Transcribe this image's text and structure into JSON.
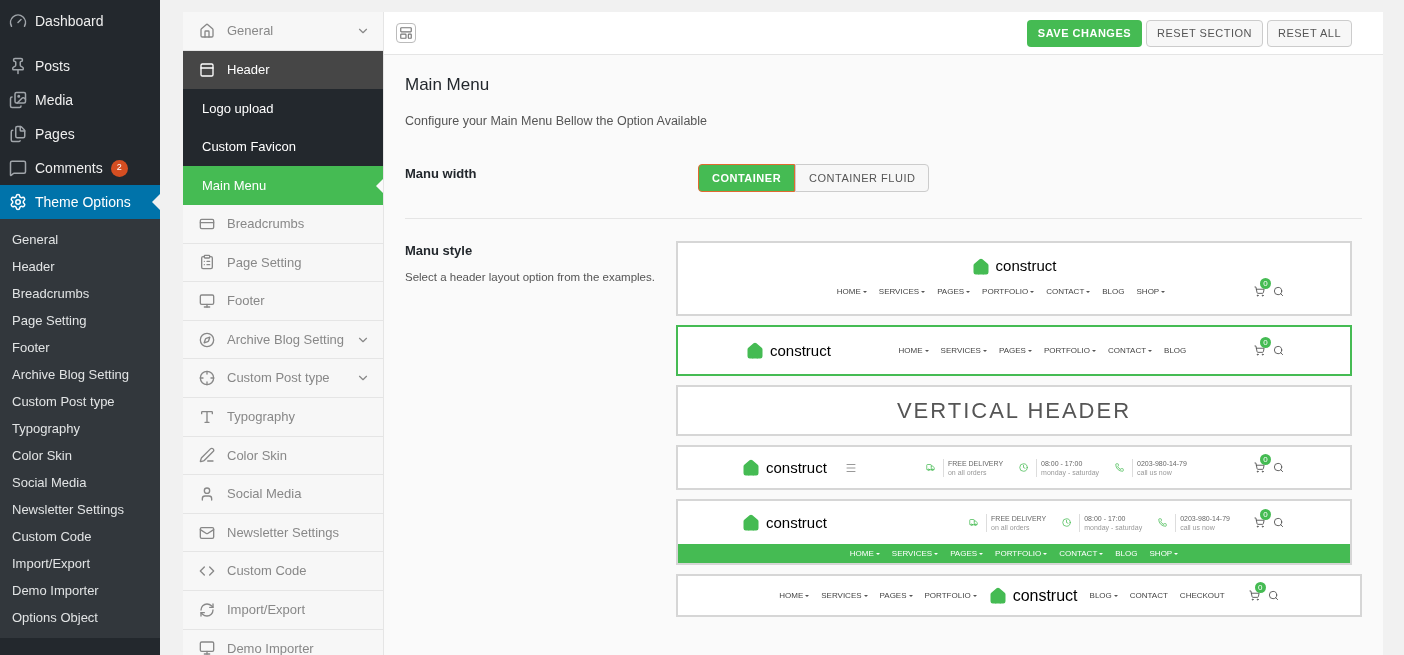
{
  "wp_menu": {
    "items": [
      {
        "label": "Dashboard",
        "selected": false
      },
      {
        "label": "Posts",
        "selected": false
      },
      {
        "label": "Media",
        "selected": false
      },
      {
        "label": "Pages",
        "selected": false
      },
      {
        "label": "Comments",
        "selected": false,
        "badge": "2"
      },
      {
        "label": "Theme Options",
        "selected": true
      }
    ],
    "submenu": [
      "General",
      "Header",
      "Breadcrumbs",
      "Page Setting",
      "Footer",
      "Archive Blog Setting",
      "Custom Post type",
      "Typography",
      "Color Skin",
      "Social Media",
      "Newsletter Settings",
      "Custom Code",
      "Import/Export",
      "Demo Importer",
      "Options Object"
    ]
  },
  "options_nav": [
    {
      "label": "General",
      "kind": "section",
      "selected": false,
      "expandable": true
    },
    {
      "label": "Header",
      "kind": "section",
      "selected": true,
      "expandable": false
    },
    {
      "label": "Logo upload",
      "kind": "sub",
      "selected": false
    },
    {
      "label": "Custom Favicon",
      "kind": "sub",
      "selected": false
    },
    {
      "label": "Main Menu",
      "kind": "sub",
      "selected": true
    },
    {
      "label": "Breadcrumbs",
      "kind": "section",
      "selected": false,
      "expandable": false
    },
    {
      "label": "Page Setting",
      "kind": "section",
      "selected": false,
      "expandable": false
    },
    {
      "label": "Footer",
      "kind": "section",
      "selected": false,
      "expandable": false
    },
    {
      "label": "Archive Blog Setting",
      "kind": "section",
      "selected": false,
      "expandable": true
    },
    {
      "label": "Custom Post type",
      "kind": "section",
      "selected": false,
      "expandable": true
    },
    {
      "label": "Typography",
      "kind": "section",
      "selected": false,
      "expandable": false
    },
    {
      "label": "Color Skin",
      "kind": "section",
      "selected": false,
      "expandable": false
    },
    {
      "label": "Social Media",
      "kind": "section",
      "selected": false,
      "expandable": false
    },
    {
      "label": "Newsletter Settings",
      "kind": "section",
      "selected": false,
      "expandable": false
    },
    {
      "label": "Custom Code",
      "kind": "section",
      "selected": false,
      "expandable": false
    },
    {
      "label": "Import/Export",
      "kind": "section",
      "selected": false,
      "expandable": false
    },
    {
      "label": "Demo Importer",
      "kind": "section",
      "selected": false,
      "expandable": false
    }
  ],
  "toolbar": {
    "buttons": [
      {
        "label": "SAVE CHANGES",
        "kind": "primary"
      },
      {
        "label": "RESET SECTION",
        "kind": "default"
      },
      {
        "label": "RESET ALL",
        "kind": "default"
      }
    ]
  },
  "section": {
    "title": "Main Menu",
    "description": "Configure your Main Menu Bellow the Option Available"
  },
  "menu_width": {
    "label": "Manu width",
    "options": [
      {
        "label": "CONTAINER",
        "selected": true
      },
      {
        "label": "CONTAINER FLUID",
        "selected": false
      }
    ]
  },
  "menu_style": {
    "label": "Manu style",
    "description": "Select a header layout option from the examples.",
    "layouts": [
      {
        "kind": "centered",
        "selected": false,
        "logo": "construct",
        "cart_count": "0",
        "nav": [
          {
            "label": "HOME",
            "dropdown": true
          },
          {
            "label": "SERVICES",
            "dropdown": true
          },
          {
            "label": "PAGES",
            "dropdown": true
          },
          {
            "label": "PORTFOLIO",
            "dropdown": true
          },
          {
            "label": "CONTACT",
            "dropdown": true
          },
          {
            "label": "BLOG",
            "dropdown": false
          },
          {
            "label": "SHOP",
            "dropdown": true
          }
        ]
      },
      {
        "kind": "inline",
        "selected": true,
        "logo": "construct",
        "cart_count": "0",
        "nav": [
          {
            "label": "HOME",
            "dropdown": true
          },
          {
            "label": "SERVICES",
            "dropdown": true
          },
          {
            "label": "PAGES",
            "dropdown": true
          },
          {
            "label": "PORTFOLIO",
            "dropdown": true
          },
          {
            "label": "CONTACT",
            "dropdown": true
          },
          {
            "label": "BLOG",
            "dropdown": false
          }
        ]
      },
      {
        "kind": "text",
        "selected": false,
        "title": "VERTICAL HEADER"
      },
      {
        "kind": "info",
        "selected": false,
        "logo": "construct",
        "cart_count": "0",
        "info": [
          {
            "title": "FREE DELIVERY",
            "sub": "on all orders"
          },
          {
            "title": "08:00 - 17:00",
            "sub": "monday - saturday"
          },
          {
            "title": "0203-980-14-79",
            "sub": "call us now"
          }
        ]
      },
      {
        "kind": "info_bar",
        "selected": false,
        "logo": "construct",
        "cart_count": "0",
        "info": [
          {
            "title": "FREE DELIVERY",
            "sub": "on all orders"
          },
          {
            "title": "08:00 - 17:00",
            "sub": "monday - saturday"
          },
          {
            "title": "0203-980-14-79",
            "sub": "call us now"
          }
        ],
        "nav": [
          {
            "label": "HOME",
            "dropdown": true
          },
          {
            "label": "SERVICES",
            "dropdown": true
          },
          {
            "label": "PAGES",
            "dropdown": true
          },
          {
            "label": "PORTFOLIO",
            "dropdown": true
          },
          {
            "label": "CONTACT",
            "dropdown": true
          },
          {
            "label": "BLOG",
            "dropdown": false
          },
          {
            "label": "SHOP",
            "dropdown": true
          }
        ]
      },
      {
        "kind": "split",
        "selected": false,
        "logo": "construct",
        "cart_count": "0",
        "nav": [
          {
            "label": "HOME",
            "dropdown": true
          },
          {
            "label": "SERVICES",
            "dropdown": true
          },
          {
            "label": "PAGES",
            "dropdown": true
          },
          {
            "label": "PORTFOLIO",
            "dropdown": true
          }
        ],
        "nav_right": [
          {
            "label": "BLOG",
            "dropdown": true
          },
          {
            "label": "CONTACT",
            "dropdown": false
          },
          {
            "label": "CHECKOUT",
            "dropdown": false
          }
        ]
      }
    ]
  }
}
